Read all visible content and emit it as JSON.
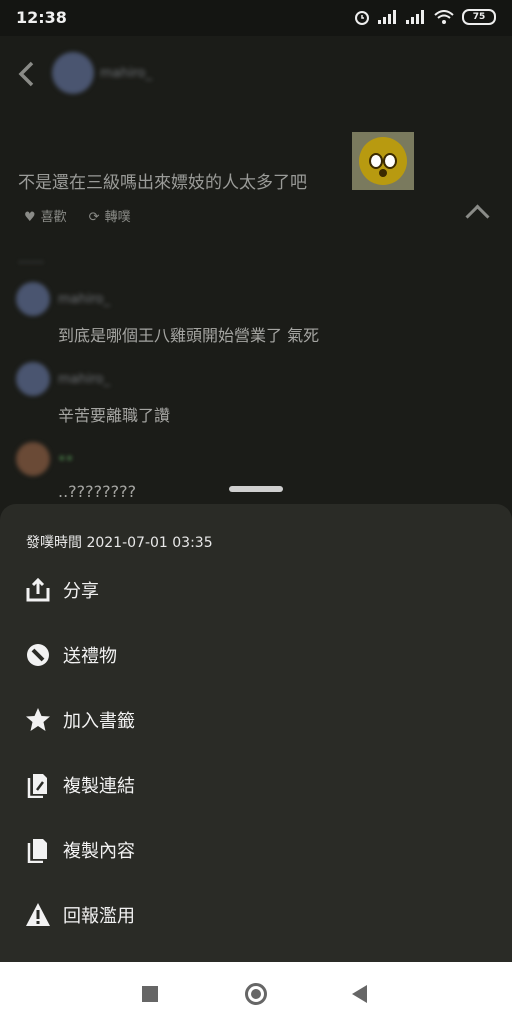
{
  "status_bar": {
    "time": "12:38",
    "battery": "75"
  },
  "post": {
    "author": "mahiro_",
    "text": "不是還在三級嗎出來嫖妓的人太多了吧",
    "actions": {
      "like": "喜歡",
      "replurk": "轉噗"
    },
    "reply_summary": "……"
  },
  "comments": [
    {
      "author": "mahiro_",
      "text": "到底是哪個王八雞頭開始營業了 氣死"
    },
    {
      "author": "mahiro_",
      "text": "辛苦要離職了讚"
    },
    {
      "author": "••",
      "text": "..????????"
    }
  ],
  "sheet": {
    "timestamp": "發噗時間 2021-07-01 03:35",
    "items": [
      {
        "label": "分享",
        "icon": "share-icon"
      },
      {
        "label": "送禮物",
        "icon": "gift-icon"
      },
      {
        "label": "加入書籤",
        "icon": "star-icon"
      },
      {
        "label": "複製連結",
        "icon": "copy-link-icon"
      },
      {
        "label": "複製內容",
        "icon": "copy-content-icon"
      },
      {
        "label": "回報濫用",
        "icon": "warning-icon"
      }
    ]
  },
  "colors": {
    "sheet_bg": "#2a2b26",
    "page_bg": "#1b1c18",
    "navbar_bg": "#ffffff"
  }
}
